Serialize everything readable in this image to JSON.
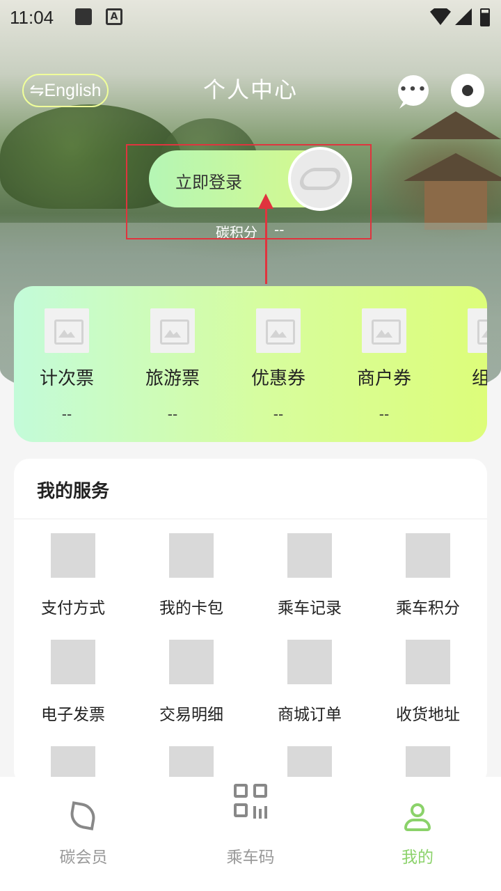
{
  "status_bar": {
    "time": "11:04",
    "icons": [
      "image-icon",
      "a-icon",
      "wifi-icon",
      "signal-icon",
      "battery-icon"
    ]
  },
  "header": {
    "language_button": "⇋English",
    "title": "个人中心",
    "message_icon": "chat-bubble-icon",
    "settings_icon": "gear-icon"
  },
  "login": {
    "button_label": "立即登录",
    "points_label": "碳积分",
    "points_value": "--"
  },
  "tickets": [
    {
      "label": "计次票",
      "value": "--"
    },
    {
      "label": "旅游票",
      "value": "--"
    },
    {
      "label": "优惠券",
      "value": "--"
    },
    {
      "label": "商户券",
      "value": "--"
    },
    {
      "label": "组合",
      "value": "-"
    }
  ],
  "services": {
    "title": "我的服务",
    "items": [
      {
        "label": "支付方式"
      },
      {
        "label": "我的卡包"
      },
      {
        "label": "乘车记录"
      },
      {
        "label": "乘车积分"
      },
      {
        "label": "电子发票"
      },
      {
        "label": "交易明细"
      },
      {
        "label": "商城订单"
      },
      {
        "label": "收货地址"
      },
      {
        "label": ""
      },
      {
        "label": ""
      },
      {
        "label": ""
      },
      {
        "label": ""
      }
    ]
  },
  "bottom_nav": [
    {
      "label": "碳会员",
      "icon": "leaf-icon",
      "active": false
    },
    {
      "label": "乘车码",
      "icon": "qr-code-icon",
      "active": false
    },
    {
      "label": "我的",
      "icon": "person-icon",
      "active": true
    }
  ],
  "colors": {
    "accent": "#8bd26a",
    "highlight_annotation": "#e0343e"
  }
}
